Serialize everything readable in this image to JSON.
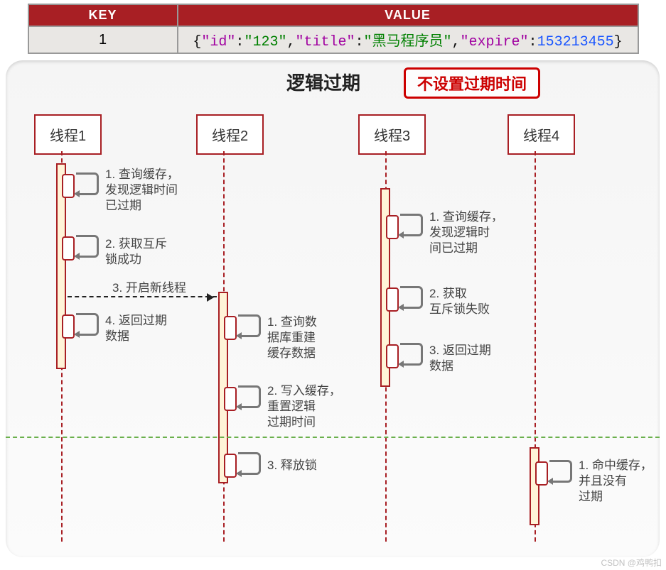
{
  "table": {
    "headers": {
      "key": "KEY",
      "value": "VALUE"
    },
    "key": "1",
    "json_id_k": "\"id\"",
    "json_id_v": "\"123\"",
    "json_title_k": "\"title\"",
    "json_title_v": "\"黑马程序员\"",
    "json_exp_k": "\"expire\"",
    "json_exp_v": "153213455"
  },
  "panel": {
    "title": "逻辑过期",
    "badge": "不设置过期时间"
  },
  "lanes": {
    "l1": "线程1",
    "l2": "线程2",
    "l3": "线程3",
    "l4": "线程4"
  },
  "steps": {
    "t1_1": "1. 查询缓存，\n发现逻辑时间\n已过期",
    "t1_2": "2. 获取互斥\n锁成功",
    "t1_3": "3. 开启新线程",
    "t1_4": "4. 返回过期\n数据",
    "t2_1": "1. 查询数\n据库重建\n缓存数据",
    "t2_2": "2. 写入缓存，\n重置逻辑\n过期时间",
    "t2_3": "3. 释放锁",
    "t3_1": "1. 查询缓存，\n发现逻辑时\n间已过期",
    "t3_2": "2. 获取\n互斥锁失败",
    "t3_3": "3. 返回过期\n数据",
    "t4_1": "1. 命中缓存，\n并且没有\n过期"
  },
  "watermark": "CSDN @鸡鸭扣"
}
